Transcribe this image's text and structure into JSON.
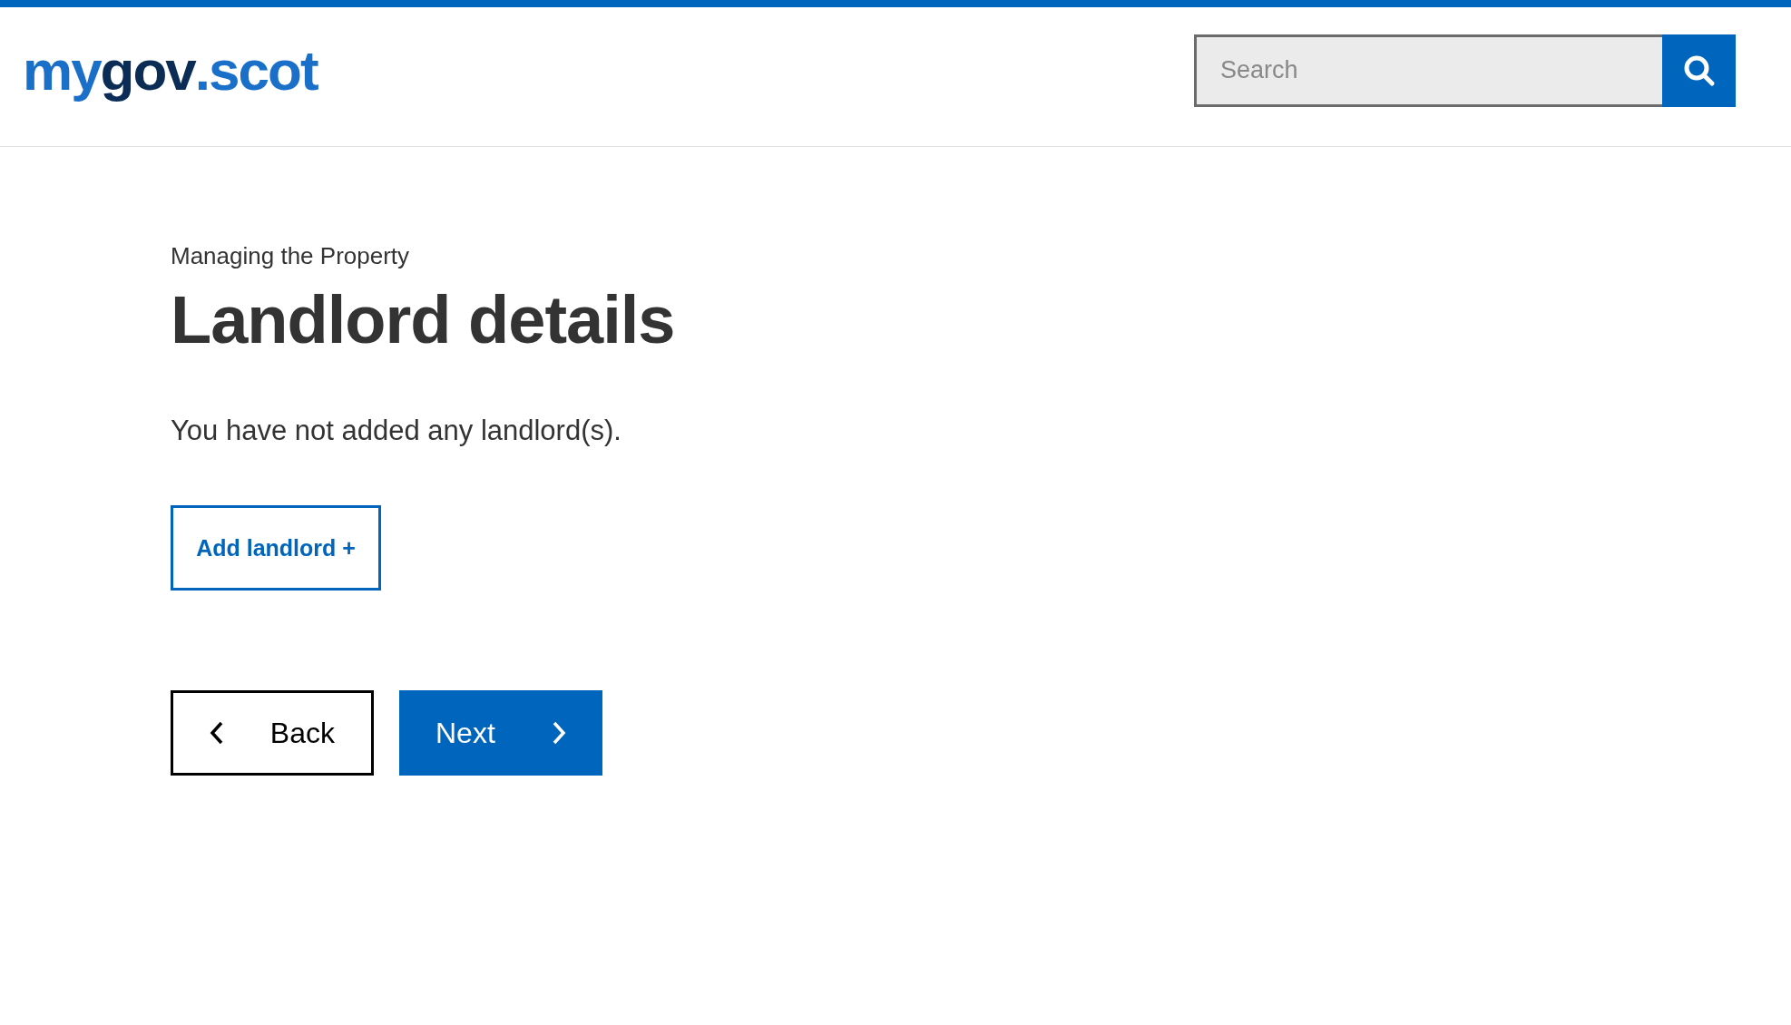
{
  "header": {
    "logo": [
      {
        "text": "my",
        "color": "#1a6fc9"
      },
      {
        "text": "gov",
        "color": "#0b2c55"
      },
      {
        "text": ".scot",
        "color": "#1a6fc9"
      }
    ],
    "search": {
      "placeholder": "Search"
    }
  },
  "page": {
    "caption": "Managing the Property",
    "title": "Landlord details",
    "message": "You have not added any landlord(s).",
    "add_button": "Add landlord +"
  },
  "nav_buttons": [
    {
      "label": "Back",
      "kind": "back"
    },
    {
      "label": "Next",
      "kind": "next"
    }
  ]
}
